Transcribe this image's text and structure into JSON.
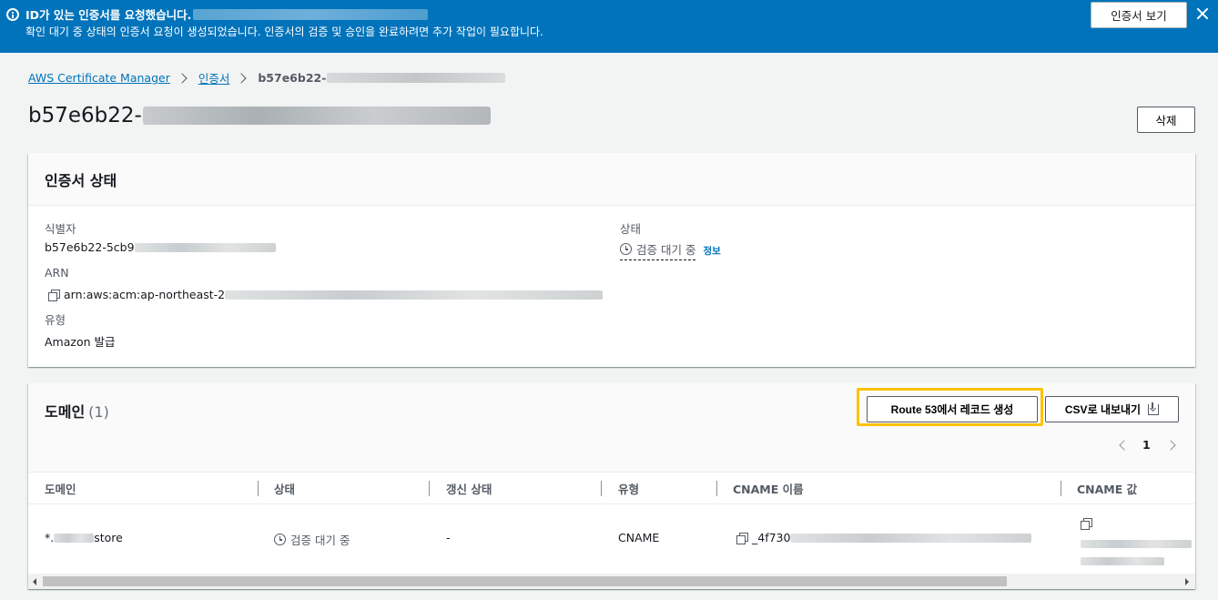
{
  "flash": {
    "title": "ID가 있는 인증서를 요청했습니다.",
    "description": "확인 대기 중 상태의 인증서 요청이 생성되었습니다. 인증서의 검증 및 승인을 완료하려면 추가 작업이 필요합니다.",
    "view_button": "인증서 보기",
    "color": "#0073bb"
  },
  "breadcrumb": {
    "items": [
      "AWS Certificate Manager",
      "인증서"
    ],
    "current": "b57e6b22-"
  },
  "page": {
    "title": "b57e6b22-",
    "delete_button": "삭제"
  },
  "status_card": {
    "heading": "인증서 상태",
    "identifier_label": "식별자",
    "identifier_value": "b57e6b22-5cb9",
    "arn_label": "ARN",
    "arn_value": "arn:aws:acm:ap-northeast-2",
    "type_label": "유형",
    "type_value": "Amazon 발급",
    "status_label": "상태",
    "status_value": "검증 대기 중",
    "info_link": "정보"
  },
  "domain_card": {
    "heading": "도메인",
    "count": "(1)",
    "route53_button": "Route 53에서 레코드 생성",
    "csv_button": "CSV로 내보내기",
    "page_number": "1",
    "highlight_color": "#ffc107",
    "columns": [
      "도메인",
      "상태",
      "갱신 상태",
      "유형",
      "CNAME 이름",
      "CNAME 값"
    ],
    "row": {
      "domain_prefix": "*.",
      "domain_suffix": "store",
      "status": "검증 대기 중",
      "renewal_status": "-",
      "type": "CNAME",
      "cname_name": "_4f730"
    }
  }
}
